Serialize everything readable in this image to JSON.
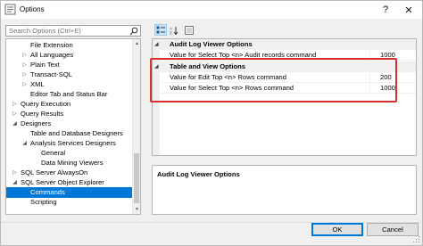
{
  "window": {
    "title": "Options",
    "help_label": "?",
    "close_label": "✕"
  },
  "search": {
    "placeholder": "Search Options (Ctrl+E)"
  },
  "tree": {
    "items": [
      {
        "label": "File Extension",
        "expander": ""
      },
      {
        "label": "All Languages",
        "expander": "▷"
      },
      {
        "label": "Plain Text",
        "expander": "▷"
      },
      {
        "label": "Transact-SQL",
        "expander": "▷"
      },
      {
        "label": "XML",
        "expander": "▷"
      },
      {
        "label": "Editor Tab and Status Bar",
        "expander": ""
      },
      {
        "label": "Query Execution",
        "expander": "▷"
      },
      {
        "label": "Query Results",
        "expander": "▷"
      },
      {
        "label": "Designers",
        "expander": "◢"
      },
      {
        "label": "Table and Database Designers",
        "expander": ""
      },
      {
        "label": "Analysis Services Designers",
        "expander": "◢"
      },
      {
        "label": "General",
        "expander": ""
      },
      {
        "label": "Data Mining Viewers",
        "expander": ""
      },
      {
        "label": "SQL Server AlwaysOn",
        "expander": "▷"
      },
      {
        "label": "SQL Server Object Explorer",
        "expander": "◢"
      },
      {
        "label": "Commands",
        "expander": ""
      },
      {
        "label": "Scripting",
        "expander": ""
      }
    ]
  },
  "grid": {
    "categories": [
      {
        "label": "Audit Log Viewer Options",
        "expander": "◢",
        "properties": [
          {
            "name": "Value for Select Top <n> Audit records command",
            "value": "1000"
          }
        ]
      },
      {
        "label": "Table and View Options",
        "expander": "◢",
        "properties": [
          {
            "name": "Value for Edit Top <n> Rows command",
            "value": "200"
          },
          {
            "name": "Value for Select Top <n> Rows command",
            "value": "1000"
          }
        ]
      }
    ]
  },
  "description": {
    "title": "Audit Log Viewer Options"
  },
  "buttons": {
    "ok_label": "OK",
    "cancel_label": "Cancel"
  },
  "colors": {
    "selection": "#0078d7",
    "highlight_box": "#d9302c"
  },
  "icons": {
    "categorized": "categorized-icon",
    "alphabetical": "alphabetical-icon",
    "property_pages": "property-pages-icon",
    "search": "search-icon"
  }
}
